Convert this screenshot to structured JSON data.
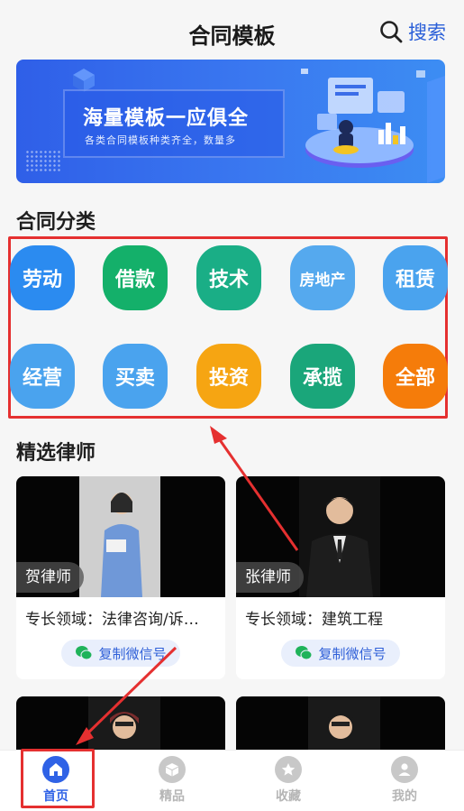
{
  "header": {
    "title": "合同模板",
    "search_label": "搜索"
  },
  "banner": {
    "title": "海量模板一应俱全",
    "subtitle": "各类合同模板种类齐全，数量多"
  },
  "categories": {
    "title": "合同分类",
    "items": [
      {
        "label": "劳动",
        "color": "#2b8bf0"
      },
      {
        "label": "借款",
        "color": "#14b06a"
      },
      {
        "label": "技术",
        "color": "#1aae86"
      },
      {
        "label": "房地产",
        "color": "#55a9ee"
      },
      {
        "label": "租赁",
        "color": "#4aa3ee"
      },
      {
        "label": "经营",
        "color": "#4aa3ee"
      },
      {
        "label": "买卖",
        "color": "#4aa3ee"
      },
      {
        "label": "投资",
        "color": "#f6a512"
      },
      {
        "label": "承揽",
        "color": "#1aa67a"
      },
      {
        "label": "全部",
        "color": "#f57c0a"
      }
    ]
  },
  "lawyers": {
    "title": "精选律师",
    "items": [
      {
        "name": "贺律师",
        "specialty": "专长领域：法律咨询/诉…",
        "button": "复制微信号"
      },
      {
        "name": "张律师",
        "specialty": "专长领域：建筑工程",
        "button": "复制微信号"
      }
    ]
  },
  "tabbar": {
    "items": [
      {
        "label": "首页",
        "icon": "home-icon",
        "active": true
      },
      {
        "label": "精品",
        "icon": "box-icon",
        "active": false
      },
      {
        "label": "收藏",
        "icon": "star-icon",
        "active": false
      },
      {
        "label": "我的",
        "icon": "user-icon",
        "active": false
      }
    ]
  },
  "colors": {
    "accent": "#2f62e6",
    "highlight": "#e53030"
  }
}
